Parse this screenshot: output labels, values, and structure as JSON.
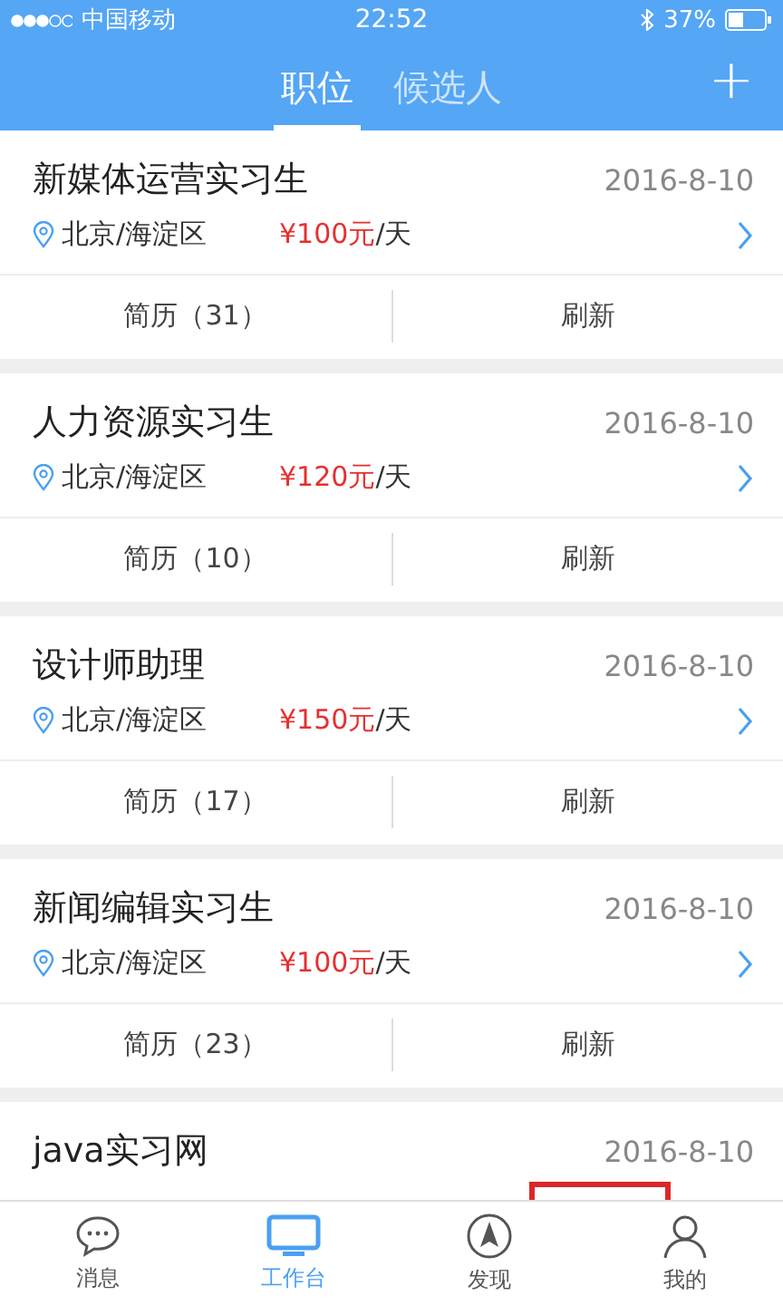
{
  "status_bar": {
    "carrier": "中国移动",
    "time": "22:52",
    "battery_text": "37%"
  },
  "header": {
    "tabs": [
      {
        "label": "职位",
        "selected": true
      },
      {
        "label": "候选人",
        "selected": false
      }
    ],
    "add_button": "+"
  },
  "jobs": [
    {
      "title": "新媒体运营实习生",
      "date": "2016-8-10",
      "location": "北京/海淀区",
      "salary": "¥100元",
      "unit": "/天",
      "resume_button": "简历（31）",
      "refresh_button": "刷新"
    },
    {
      "title": "人力资源实习生",
      "date": "2016-8-10",
      "location": "北京/海淀区",
      "salary": "¥120元",
      "unit": "/天",
      "resume_button": "简历（10）",
      "refresh_button": "刷新"
    },
    {
      "title": "设计师助理",
      "date": "2016-8-10",
      "location": "北京/海淀区",
      "salary": "¥150元",
      "unit": "/天",
      "resume_button": "简历（17）",
      "refresh_button": "刷新"
    },
    {
      "title": "新闻编辑实习生",
      "date": "2016-8-10",
      "location": "北京/海淀区",
      "salary": "¥100元",
      "unit": "/天",
      "resume_button": "简历（23）",
      "refresh_button": "刷新"
    },
    {
      "title": "java实习网",
      "date": "2016-8-10",
      "stamp": true
    }
  ],
  "tab_bar": [
    {
      "label": "消息",
      "kind": "chat",
      "selected": false
    },
    {
      "label": "工作台",
      "kind": "monitor",
      "selected": true
    },
    {
      "label": "发现",
      "kind": "compass",
      "selected": false
    },
    {
      "label": "我的",
      "kind": "person",
      "selected": false
    }
  ]
}
